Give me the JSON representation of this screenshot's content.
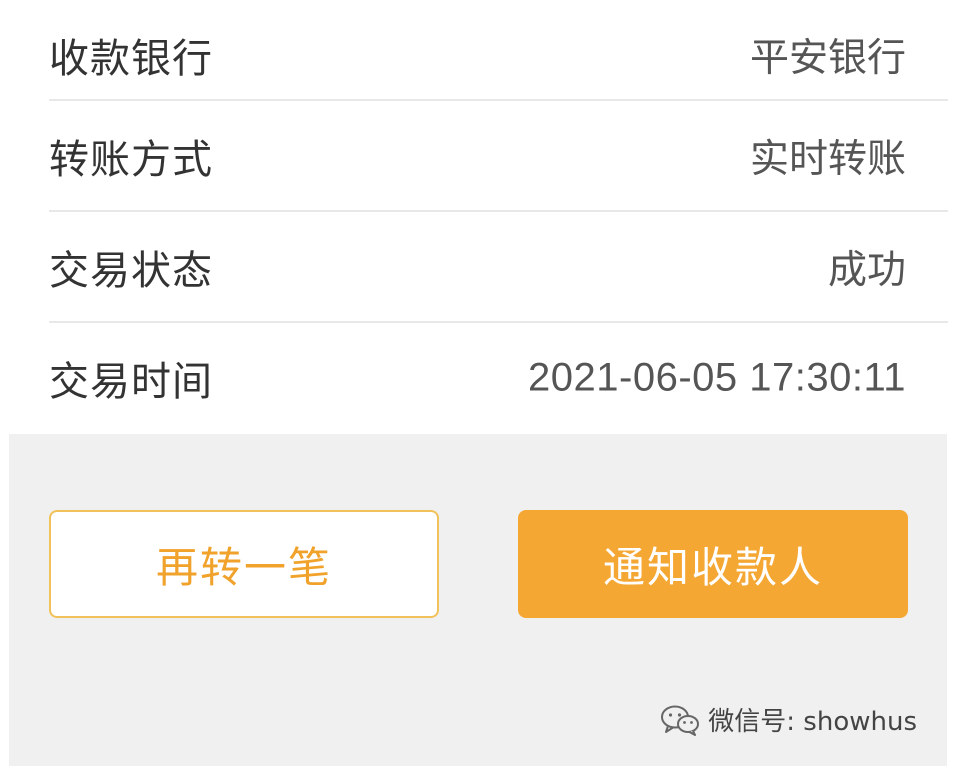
{
  "details": {
    "rows": [
      {
        "label": "收款银行",
        "value": "平安银行"
      },
      {
        "label": "转账方式",
        "value": "实时转账"
      },
      {
        "label": "交易状态",
        "value": "成功"
      },
      {
        "label": "交易时间",
        "value": "2021-06-05 17:30:11"
      }
    ]
  },
  "actions": {
    "again_label": "再转一笔",
    "notify_label": "通知收款人"
  },
  "watermark": {
    "text": "微信号: showhus",
    "icon": "wechat-icon"
  },
  "colors": {
    "accent": "#f5a733",
    "accent_text": "#f0a22b",
    "accent_border": "#f2c25a",
    "background_gray": "#f0f0f0"
  }
}
